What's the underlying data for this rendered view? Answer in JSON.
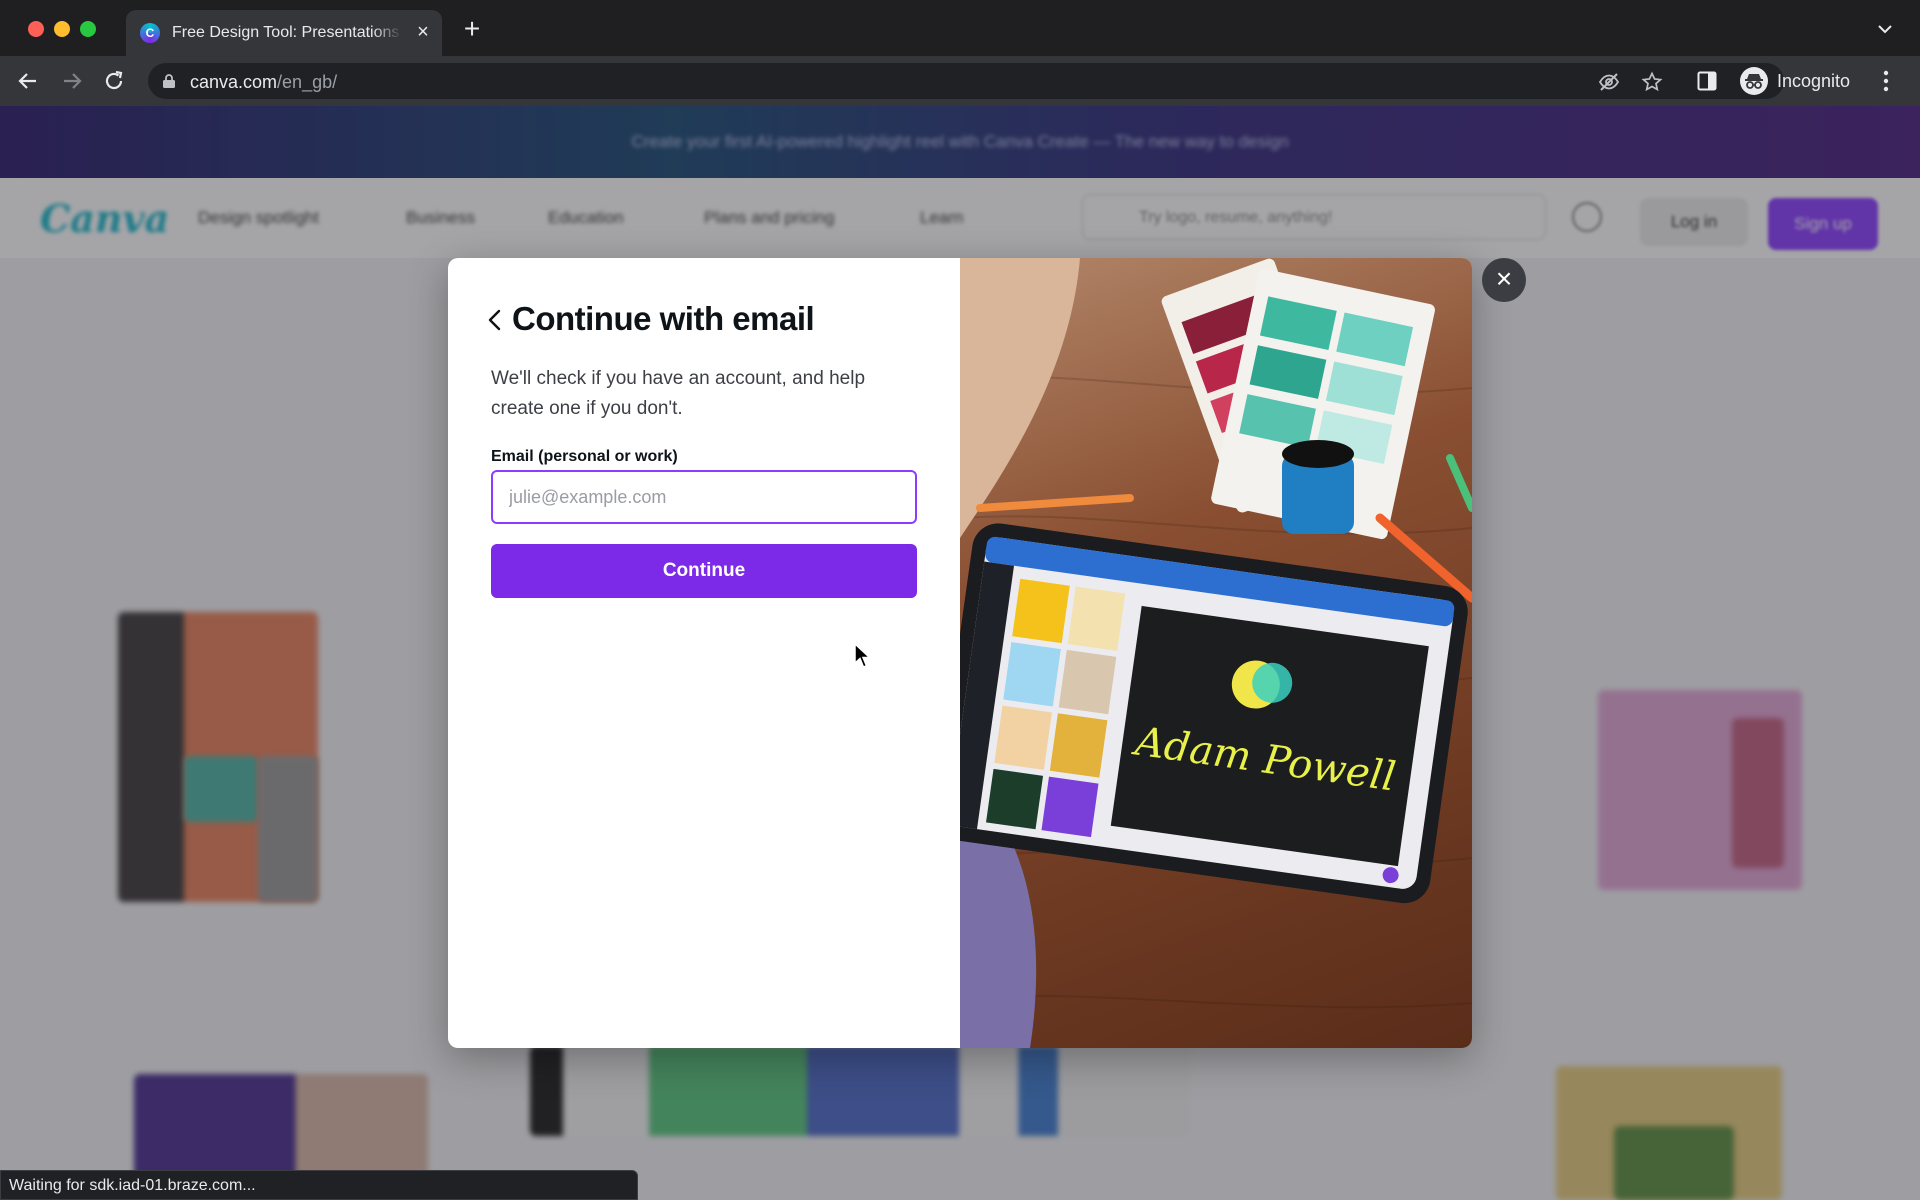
{
  "browser": {
    "tab_title": "Free Design Tool: Presentations, Video, Social Media | Canva",
    "url_host": "canva.com",
    "url_path": "/en_gb/",
    "profile_label": "Incognito",
    "status_text": "Waiting for sdk.iad-01.braze.com..."
  },
  "site": {
    "promo_text": "Create your first AI-powered highlight reel with Canva Create — The new way to design",
    "logo": "Canva",
    "nav": [
      "Design spotlight",
      "Business",
      "Education",
      "Plans and pricing",
      "Learn"
    ],
    "search_placeholder": "Try logo, resume, anything!",
    "login_label": "Log in",
    "signup_label": "Sign up"
  },
  "modal": {
    "title": "Continue with email",
    "description": "We'll check if you have an account, and help create one if you don't.",
    "email_label": "Email (personal or work)",
    "email_placeholder": "julie@example.com",
    "email_value": "",
    "continue_label": "Continue",
    "illustration_text": "Adam Powell"
  },
  "colors": {
    "accent": "#7d2ae8",
    "input_border": "#8b3dff",
    "text_primary": "#0e1318"
  }
}
